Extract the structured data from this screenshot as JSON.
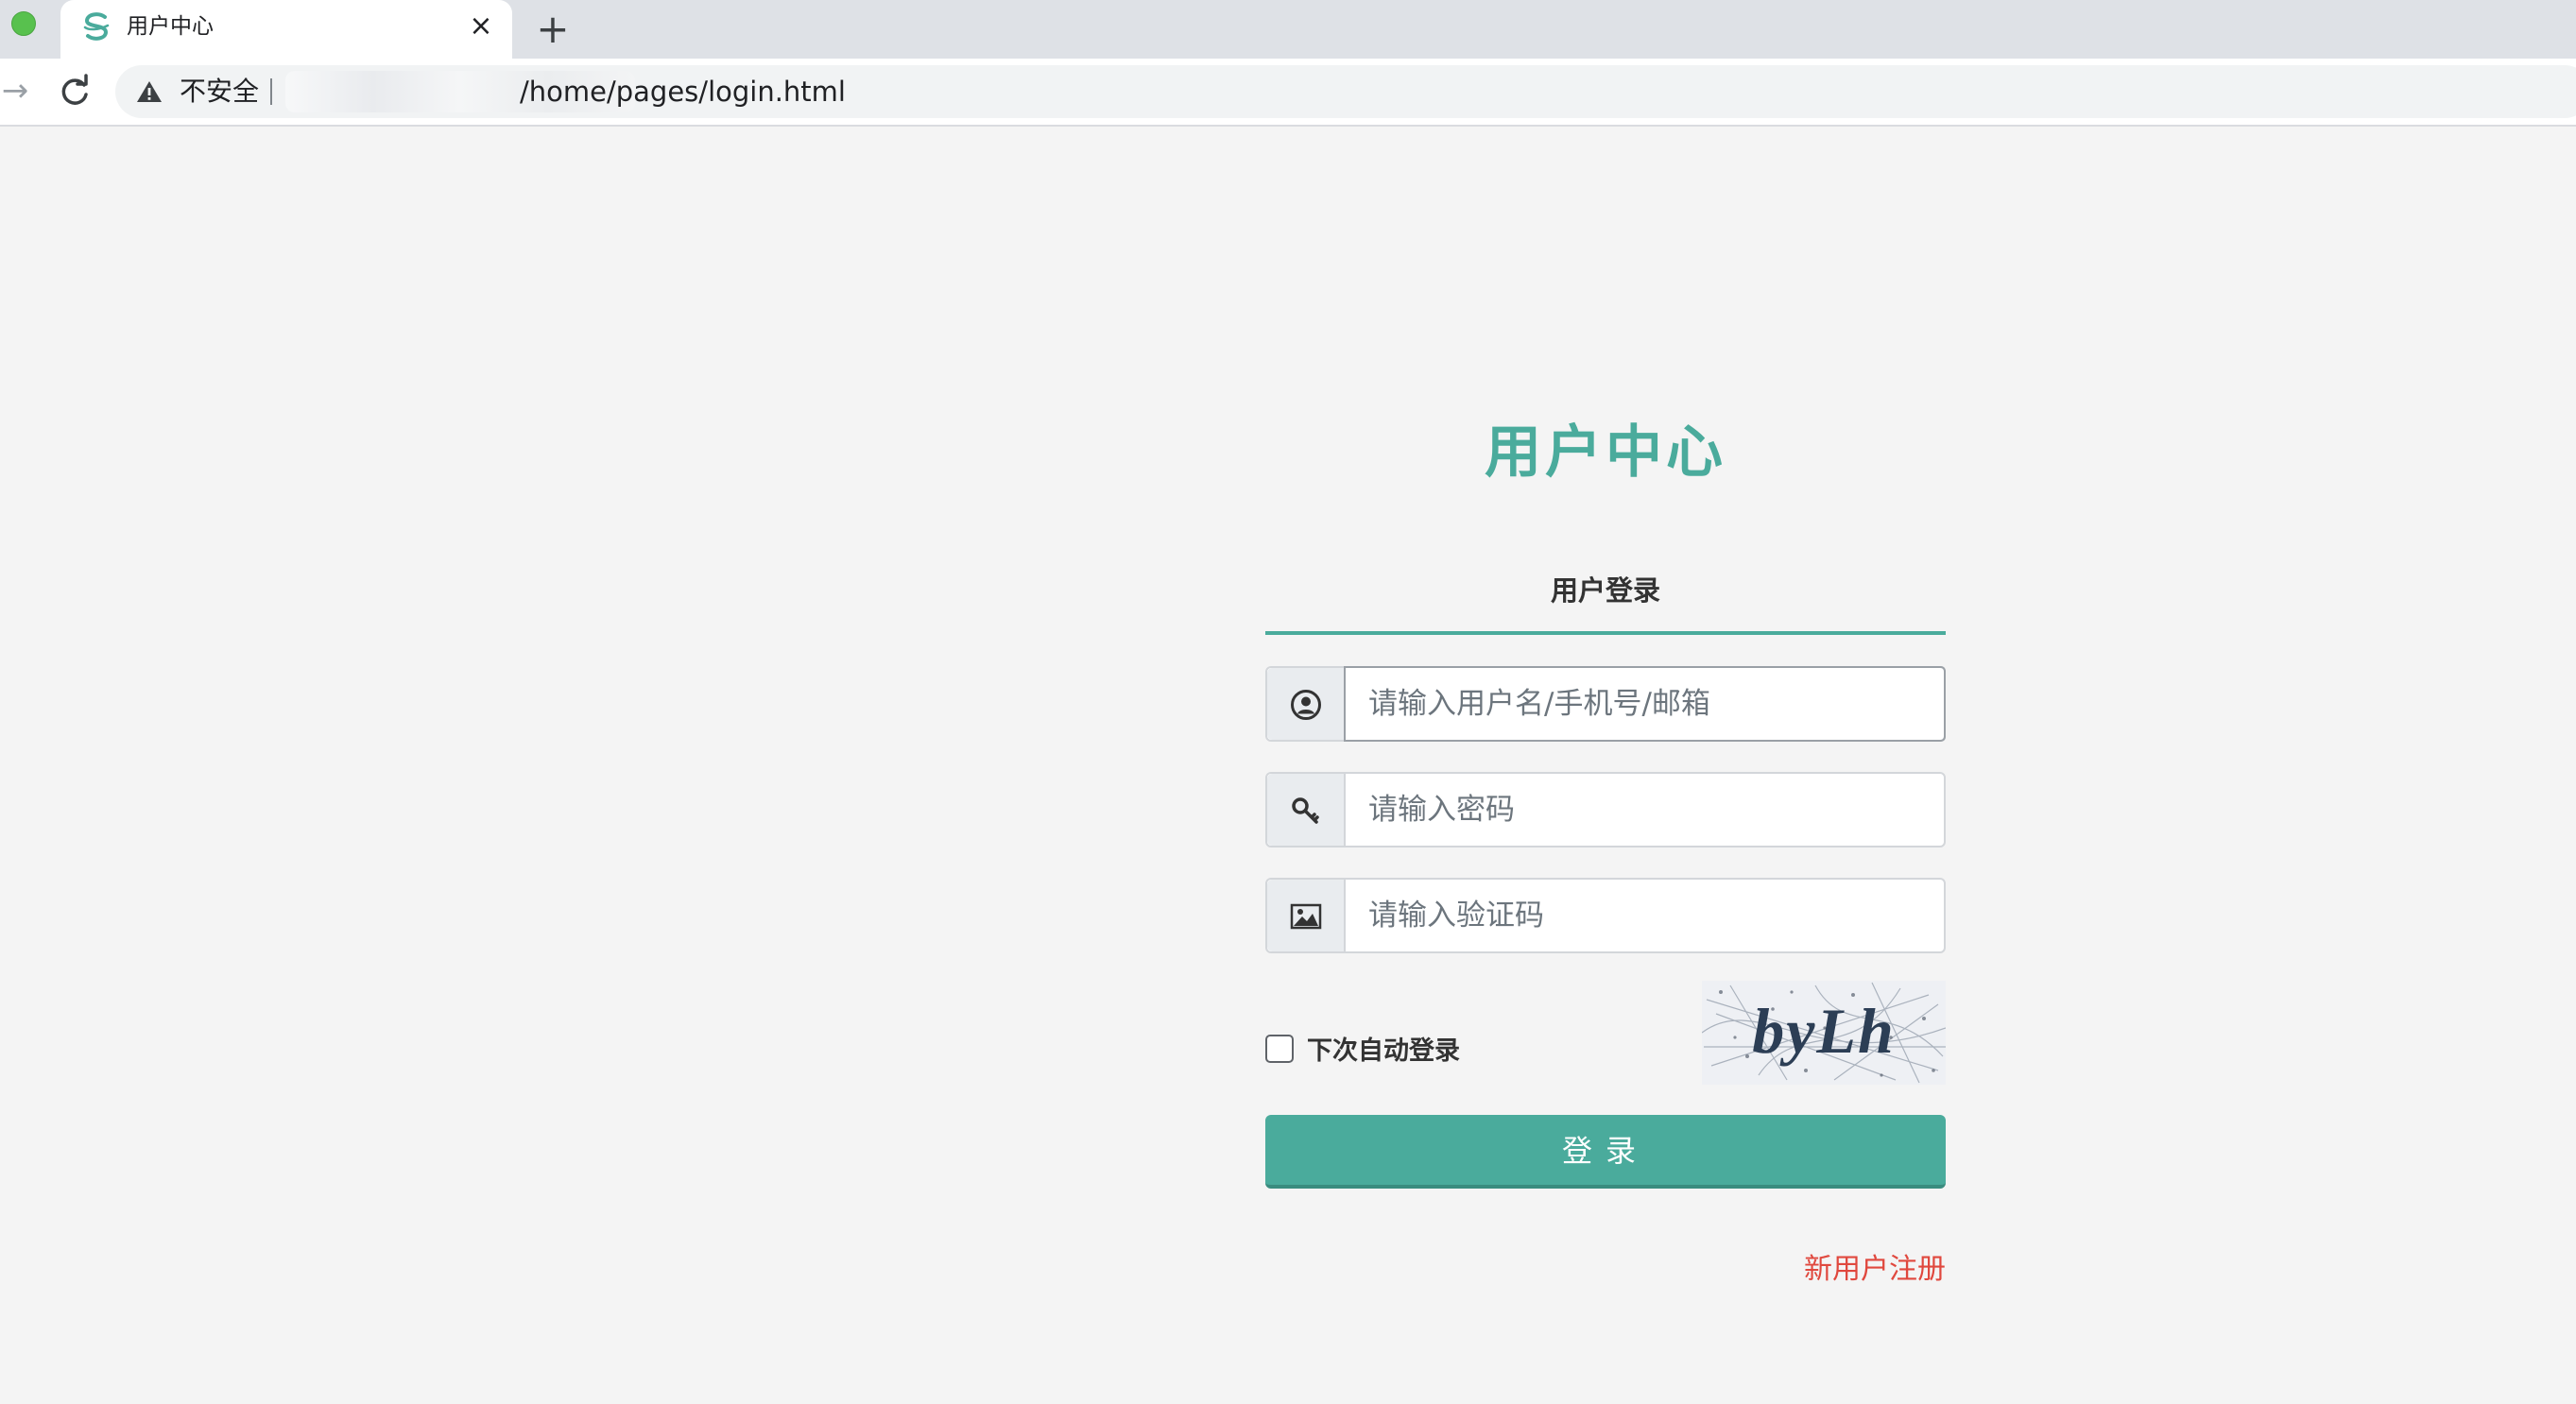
{
  "browser": {
    "tab_title": "用户中心",
    "tab_close": "×",
    "new_tab": "+",
    "security_label": "不安全",
    "url": "/home/pages/login.html"
  },
  "login": {
    "page_title": "用户中心",
    "tab_label": "用户登录",
    "username_placeholder": "请输入用户名/手机号/邮箱",
    "password_placeholder": "请输入密码",
    "captcha_placeholder": "请输入验证码",
    "remember_label": "下次自动登录",
    "remember_checked": false,
    "captcha_text": "byLh",
    "submit_label": "登录",
    "register_link": "新用户注册"
  },
  "colors": {
    "accent": "#4aab9c",
    "link_red": "#e0483e",
    "page_bg": "#f4f4f4"
  },
  "icons": {
    "username": "user-circle-icon",
    "password": "key-icon",
    "captcha": "image-icon"
  }
}
